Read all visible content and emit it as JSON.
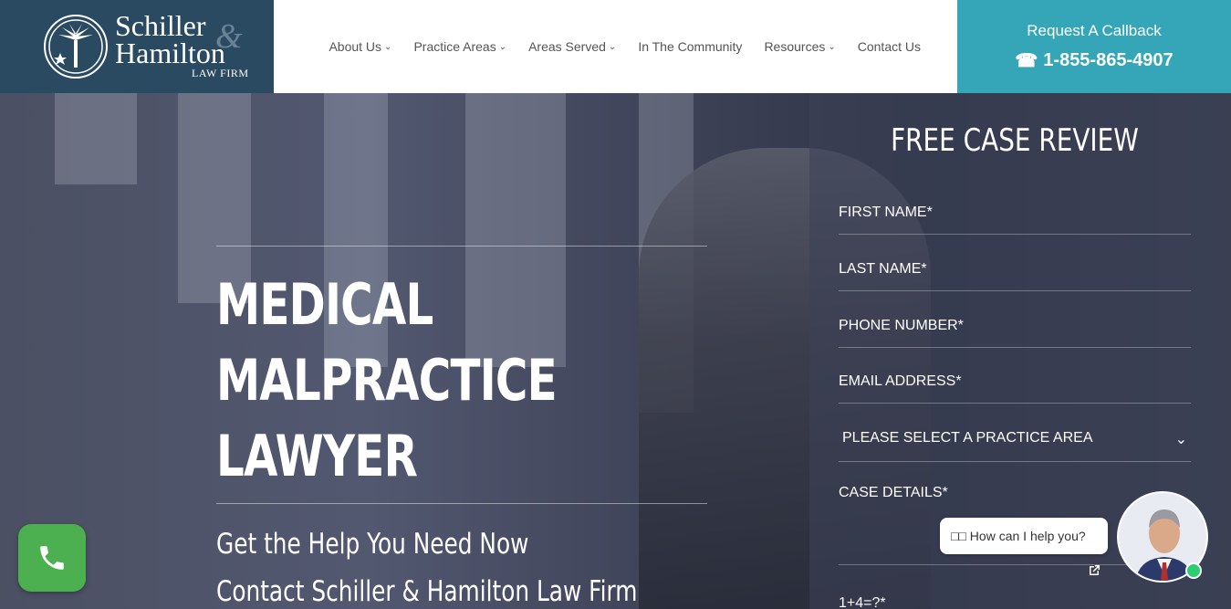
{
  "logo": {
    "name_line1": "Schiller",
    "ampersand": "&",
    "name_line2": "Hamilton",
    "subtitle": "LAW FIRM"
  },
  "nav": {
    "items": [
      {
        "label": "About Us",
        "has_dropdown": true
      },
      {
        "label": "Practice Areas",
        "has_dropdown": true
      },
      {
        "label": "Areas Served",
        "has_dropdown": true
      },
      {
        "label": "In The Community",
        "has_dropdown": false
      },
      {
        "label": "Resources",
        "has_dropdown": true
      },
      {
        "label": "Contact Us",
        "has_dropdown": false
      }
    ],
    "chevron": "⌄"
  },
  "callback": {
    "title": "Request A Callback",
    "phone_icon": "☎",
    "phone": "1-855-865-4907",
    "color": "#35a5b8"
  },
  "hero": {
    "title_lines": [
      "MEDICAL",
      "MALPRACTICE",
      "LAWYER"
    ],
    "subtitle_line1": "Get the Help You Need Now",
    "subtitle_line2": "Contact Schiller & Hamilton Law Firm"
  },
  "form": {
    "title": "FREE CASE REVIEW",
    "fields": {
      "first_name": "FIRST NAME*",
      "last_name": "LAST NAME*",
      "phone": "PHONE NUMBER*",
      "email": "EMAIL ADDRESS*",
      "practice_area": "PLEASE SELECT A PRACTICE AREA",
      "case_details": "CASE DETAILS*",
      "captcha": "1+4=?*"
    },
    "select_chevron": "⌄"
  },
  "chat": {
    "prompt": "□□ How can I help you?"
  },
  "colors": {
    "brand_dark": "#2a4a62",
    "accent_teal": "#35a5b8",
    "call_green": "#4caf50"
  }
}
